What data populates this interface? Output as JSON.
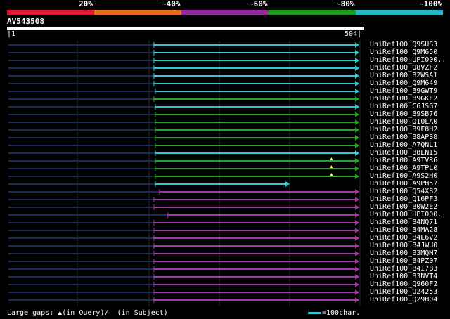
{
  "legend": {
    "segments": [
      {
        "color": "#e0192f",
        "label": "20%"
      },
      {
        "color": "#e36b1b",
        "label": "~40%"
      },
      {
        "color": "#93299a",
        "label": "~60%"
      },
      {
        "color": "#169b16",
        "label": "~80%"
      },
      {
        "color": "#1fb9c3",
        "label": "~100%"
      }
    ]
  },
  "query": {
    "id": "AV543508",
    "start": "1",
    "end": "504"
  },
  "hits": [
    {
      "label": "UniRef100_Q9SUS3",
      "color": "#2ec9d4",
      "start": 210,
      "end": 504,
      "gap_marks": []
    },
    {
      "label": "UniRef100_Q9M650",
      "color": "#2ec9d4",
      "start": 210,
      "end": 504,
      "gap_marks": []
    },
    {
      "label": "UniRef100_UPI000..",
      "color": "#2ec9d4",
      "start": 210,
      "end": 504,
      "gap_marks": []
    },
    {
      "label": "UniRef100_Q8VZF2",
      "color": "#2ec9d4",
      "start": 210,
      "end": 504,
      "gap_marks": []
    },
    {
      "label": "UniRef100_B2WSA1",
      "color": "#2ec9d4",
      "start": 210,
      "end": 504,
      "gap_marks": []
    },
    {
      "label": "UniRef100_Q9M649",
      "color": "#2ec9d4",
      "start": 210,
      "end": 504,
      "gap_marks": []
    },
    {
      "label": "UniRef100_B9GWT9",
      "color": "#2ec9d4",
      "start": 212,
      "end": 504,
      "gap_marks": []
    },
    {
      "label": "UniRef100_B9GKF2",
      "color": "#22a822",
      "start": 210,
      "end": 504,
      "gap_marks": []
    },
    {
      "label": "UniRef100_C6JSG7",
      "color": "#2ec9d4",
      "start": 212,
      "end": 504,
      "gap_marks": []
    },
    {
      "label": "UniRef100_B9SB76",
      "color": "#22a822",
      "start": 212,
      "end": 504,
      "gap_marks": []
    },
    {
      "label": "UniRef100_Q10LA0",
      "color": "#22a822",
      "start": 212,
      "end": 504,
      "gap_marks": []
    },
    {
      "label": "UniRef100_B9F8H2",
      "color": "#22a822",
      "start": 212,
      "end": 504,
      "gap_marks": []
    },
    {
      "label": "UniRef100_B8APS8",
      "color": "#22a822",
      "start": 212,
      "end": 504,
      "gap_marks": []
    },
    {
      "label": "UniRef100_A7QNL1",
      "color": "#22a822",
      "start": 212,
      "end": 504,
      "gap_marks": []
    },
    {
      "label": "UniRef100_B8LNI5",
      "color": "#2ec9d4",
      "start": 212,
      "end": 504,
      "gap_marks": []
    },
    {
      "label": "UniRef100_A9TVR6",
      "color": "#22a822",
      "start": 212,
      "end": 504,
      "gap_marks": [
        465
      ]
    },
    {
      "label": "UniRef100_A9TPL0",
      "color": "#22a822",
      "start": 212,
      "end": 504,
      "gap_marks": [
        465
      ]
    },
    {
      "label": "UniRef100_A9S2H0",
      "color": "#22a822",
      "start": 212,
      "end": 504,
      "gap_marks": [
        465
      ]
    },
    {
      "label": "UniRef100_A9PH57",
      "color": "#2ec9d4",
      "start": 212,
      "end": 404,
      "gap_marks": []
    },
    {
      "label": "UniRef100_Q54X82",
      "color": "#a43aa8",
      "start": 218,
      "end": 504,
      "gap_marks": []
    },
    {
      "label": "UniRef100_Q16PF3",
      "color": "#a43aa8",
      "start": 210,
      "end": 504,
      "gap_marks": []
    },
    {
      "label": "UniRef100_B0W2E2",
      "color": "#a43aa8",
      "start": 210,
      "end": 504,
      "gap_marks": []
    },
    {
      "label": "UniRef100_UPI000..",
      "color": "#a43aa8",
      "start": 230,
      "end": 504,
      "gap_marks": []
    },
    {
      "label": "UniRef100_B4NQ71",
      "color": "#a43aa8",
      "start": 210,
      "end": 504,
      "gap_marks": []
    },
    {
      "label": "UniRef100_B4MA28",
      "color": "#a43aa8",
      "start": 210,
      "end": 504,
      "gap_marks": []
    },
    {
      "label": "UniRef100_B4L6V2",
      "color": "#a43aa8",
      "start": 210,
      "end": 504,
      "gap_marks": []
    },
    {
      "label": "UniRef100_B4JWU0",
      "color": "#a43aa8",
      "start": 210,
      "end": 504,
      "gap_marks": []
    },
    {
      "label": "UniRef100_B3MQM7",
      "color": "#a43aa8",
      "start": 210,
      "end": 504,
      "gap_marks": []
    },
    {
      "label": "UniRef100_B4PZ07",
      "color": "#a43aa8",
      "start": 210,
      "end": 504,
      "gap_marks": []
    },
    {
      "label": "UniRef100_B4I7B3",
      "color": "#a43aa8",
      "start": 210,
      "end": 504,
      "gap_marks": []
    },
    {
      "label": "UniRef100_B3NVT4",
      "color": "#a43aa8",
      "start": 210,
      "end": 504,
      "gap_marks": []
    },
    {
      "label": "UniRef100_Q960F2",
      "color": "#a43aa8",
      "start": 210,
      "end": 504,
      "gap_marks": []
    },
    {
      "label": "UniRef100_Q24253",
      "color": "#a43aa8",
      "start": 210,
      "end": 504,
      "gap_marks": []
    },
    {
      "label": "UniRef100_Q29H04",
      "color": "#a43aa8",
      "start": 210,
      "end": 504,
      "gap_marks": []
    }
  ],
  "footer": {
    "gaps_text": "Large gaps: ▲(in Query)/⁻ (in Subject)",
    "scale_text": "=100char.",
    "scale_color": "#2ec9d4"
  }
}
